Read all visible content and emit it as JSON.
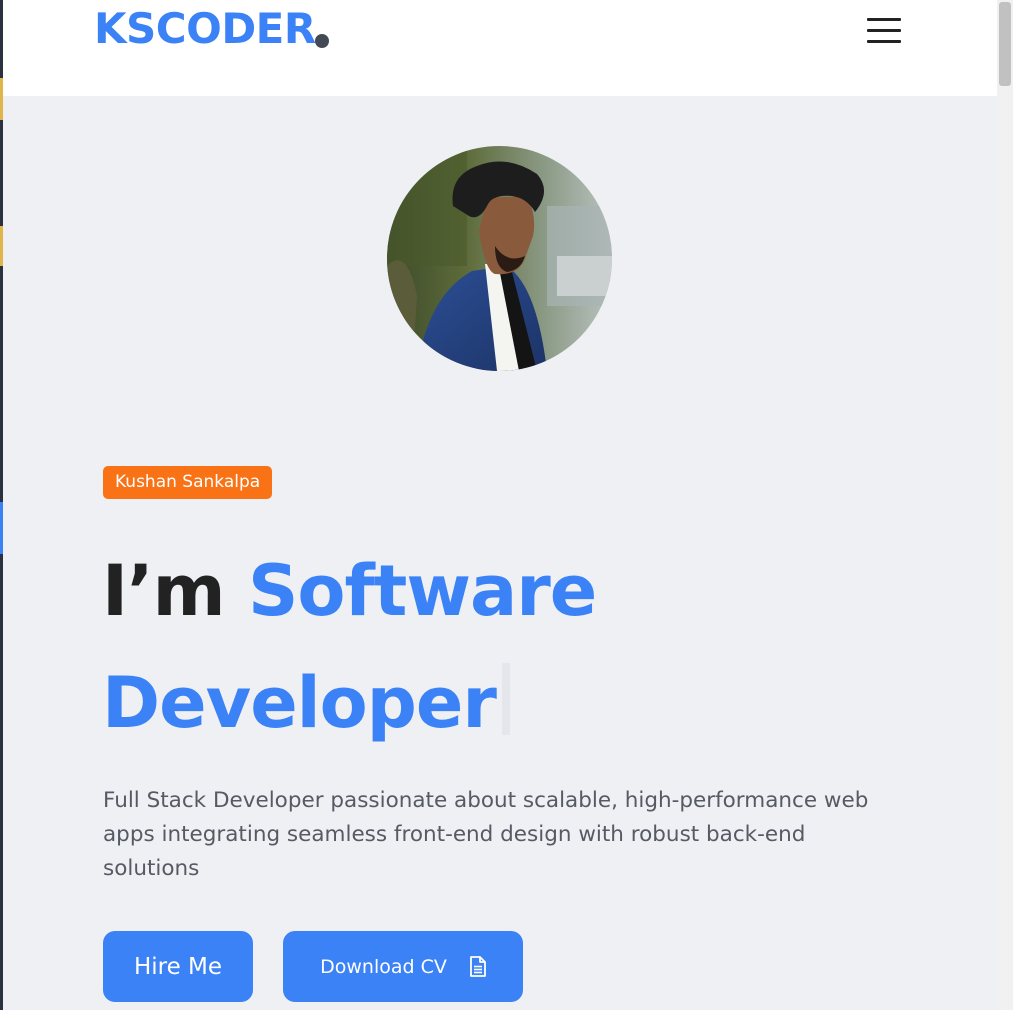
{
  "header": {
    "logo_text": "KSCODER",
    "menu_icon": "hamburger-menu-icon"
  },
  "hero": {
    "name_badge": "Kushan Sankalpa",
    "headline_prefix": "I’m",
    "headline_highlight": "Software Developer",
    "description": "Full Stack Developer passionate about scalable, high-performance web apps integrating seamless front-end design with robust back-end solutions",
    "hire_button": "Hire Me",
    "download_button": "Download CV",
    "download_icon": "document-icon"
  },
  "colors": {
    "accent": "#3b82f6",
    "badge": "#f97316",
    "background": "#eff0f4",
    "text_dark": "#222222",
    "text_muted": "#555a63"
  }
}
